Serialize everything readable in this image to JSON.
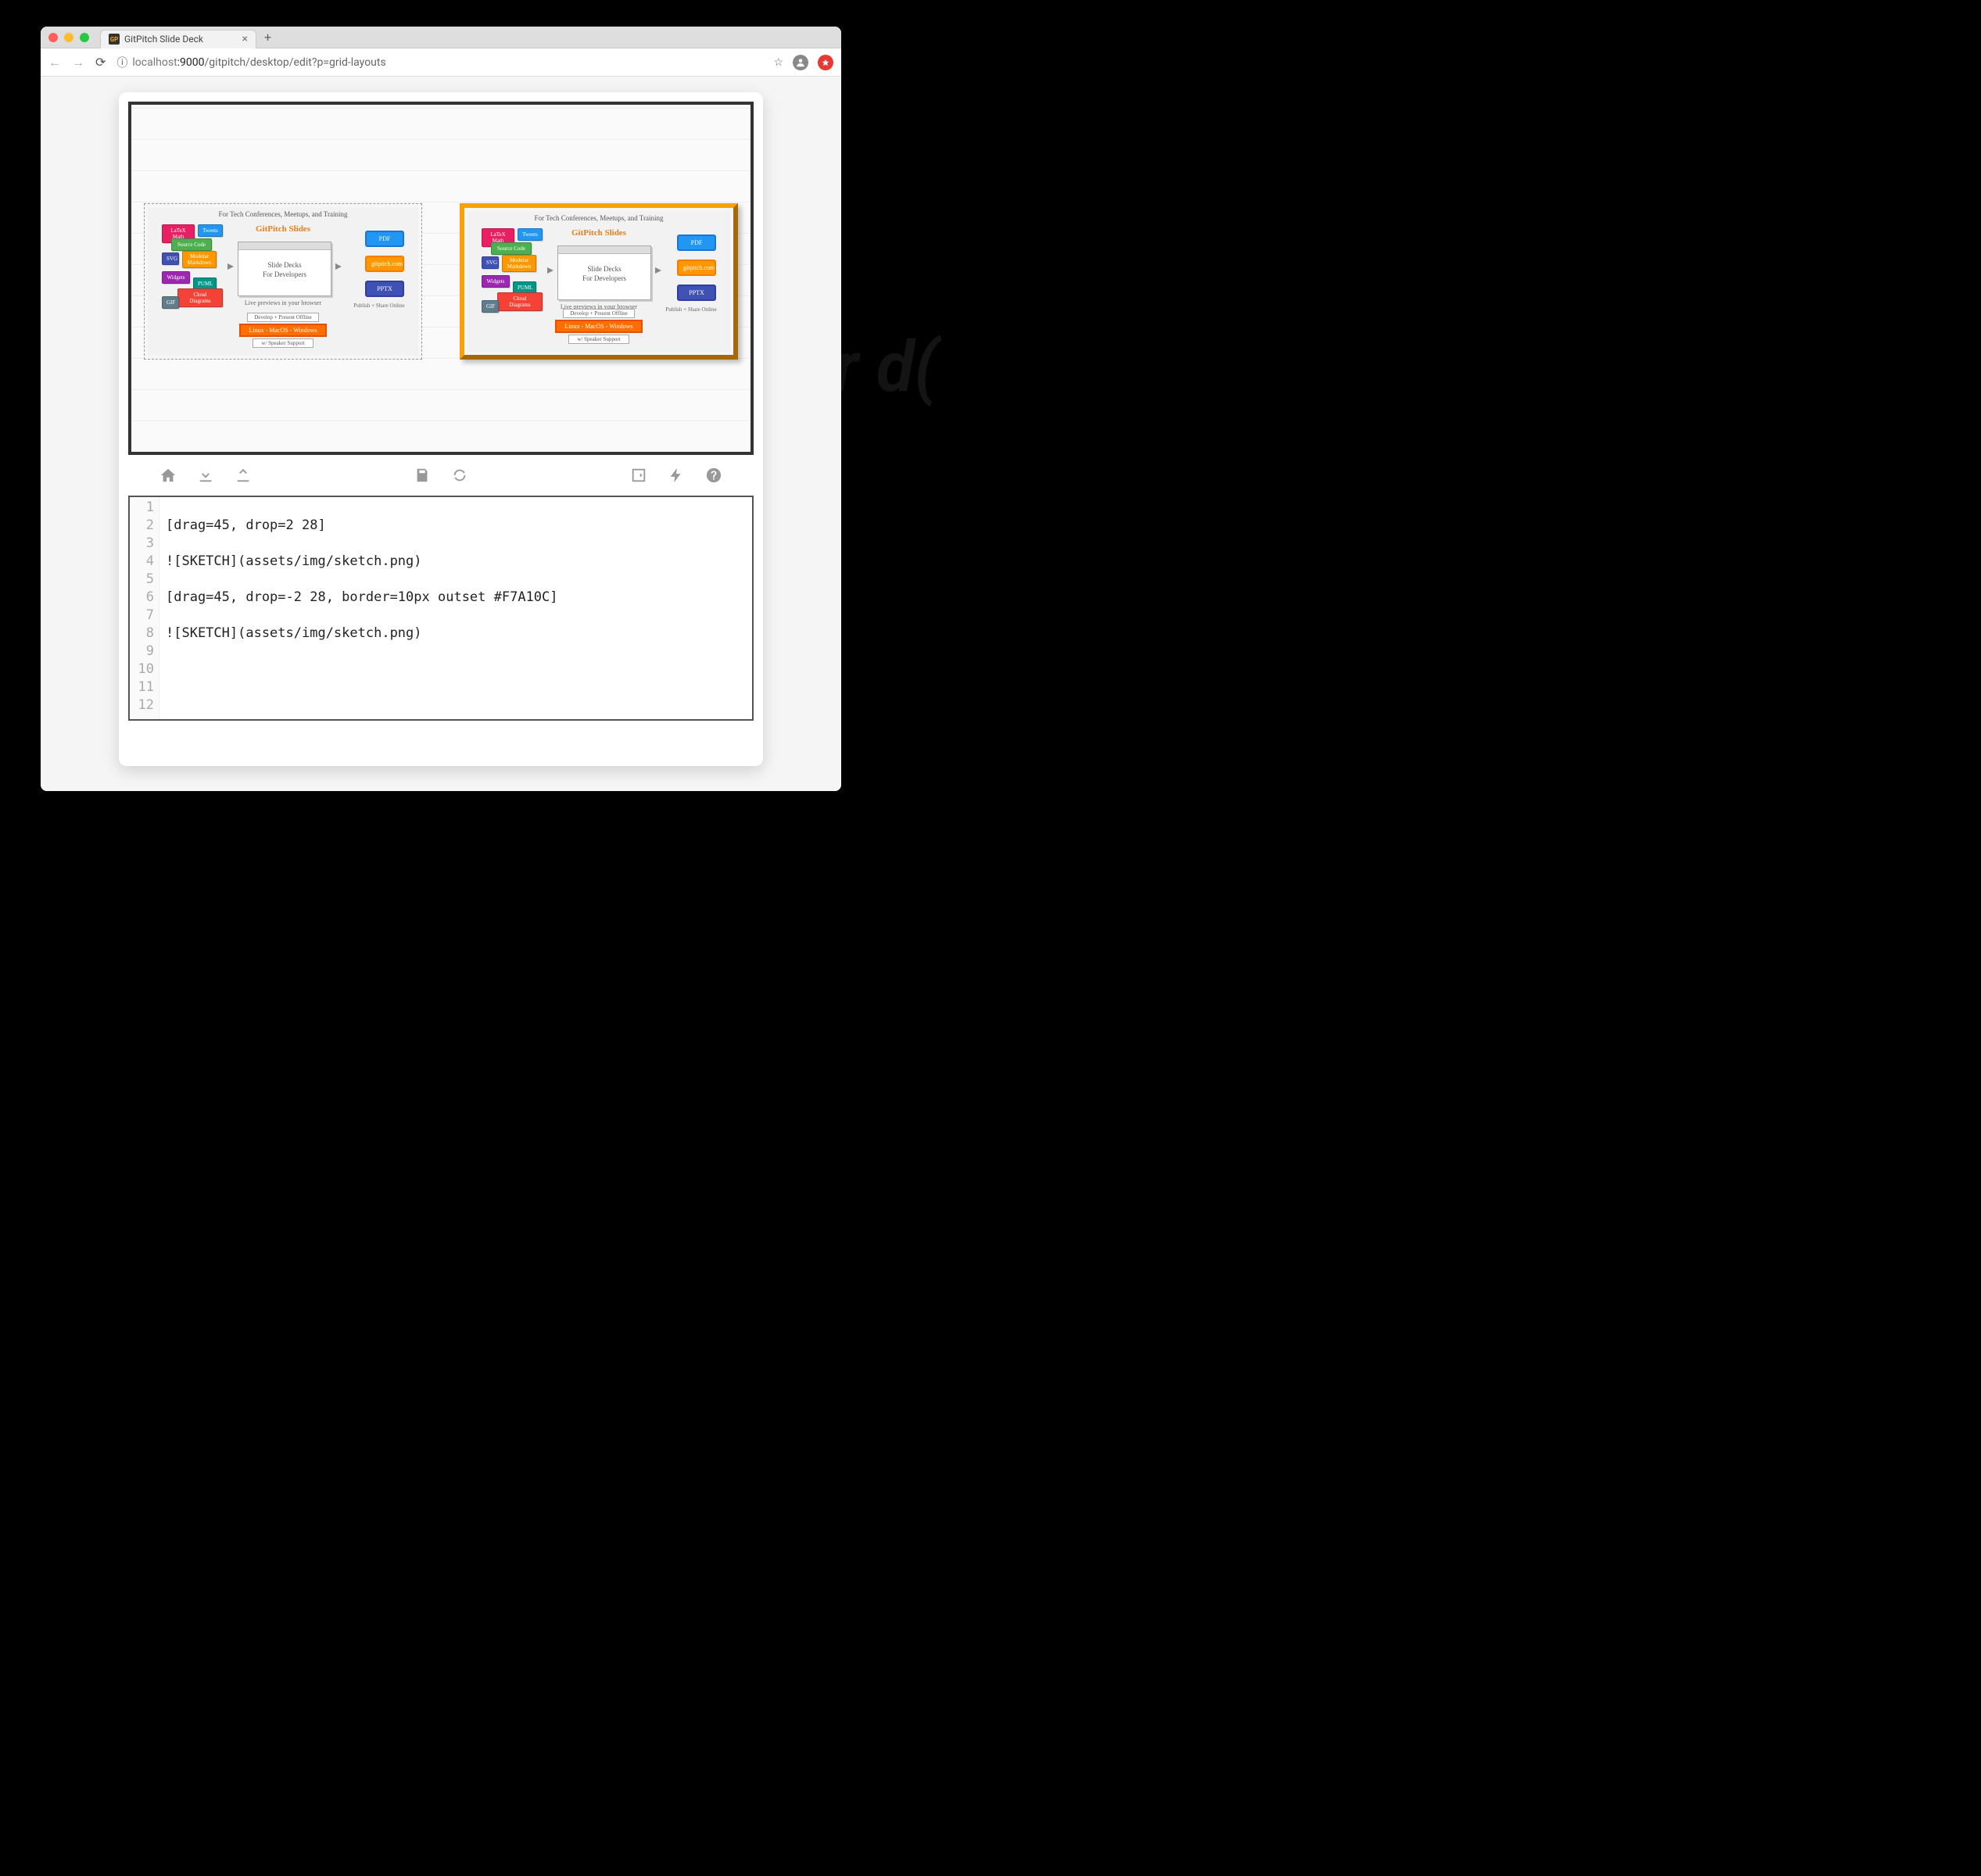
{
  "ghost": "et\npa\nar\nd(",
  "browser": {
    "tab_title": "GitPitch Slide Deck",
    "favicon_text": "GP",
    "url_scheme_icon": "ⓘ",
    "url_host_faint": "localhost",
    "url_port": ":9000",
    "url_path": "/gitpitch/desktop/edit?p=grid-layouts"
  },
  "slide": {
    "sketch_title": "For Tech Conferences, Meetups, and Training",
    "sketch_heading": "GitPitch Slides",
    "center_line1": "Slide Decks",
    "center_line2": "For Developers",
    "previews": "Live previews in your browser",
    "tags": {
      "latex": "LaTeX Math",
      "tweets": "Tweets",
      "source": "Source Code",
      "svg": "SVG",
      "modular": "Modular Markdown",
      "widgets": "Widgets",
      "puml": "PUML",
      "cloud": "Cloud Diagrams",
      "gif": "GIF"
    },
    "outputs": {
      "pdf": "PDF",
      "site": "gitpitch.com",
      "pptx": "PPTX",
      "label": "Publish + Share Online"
    },
    "bottom": {
      "develop": "Develop + Present Offline",
      "os": "Linux - MacOS - Windows",
      "speaker": "w/ Speaker Support"
    }
  },
  "editor": {
    "line_count": 12,
    "lines": [
      "",
      "[drag=45, drop=2 28]",
      "",
      "![SKETCH](assets/img/sketch.png)",
      "",
      "[drag=45, drop=-2 28, border=10px outset #F7A10C]",
      "",
      "![SKETCH](assets/img/sketch.png)",
      "",
      "",
      "",
      ""
    ]
  }
}
